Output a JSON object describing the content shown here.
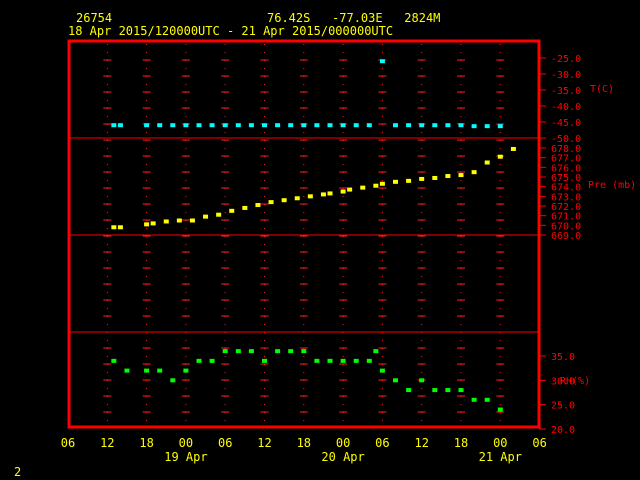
{
  "header": {
    "station_id": "26754",
    "location": "76.42S   -77.03E   2824M",
    "time_range": "18 Apr 2015/120000UTC - 21 Apr 2015/000000UTC"
  },
  "footer": {
    "page_number": "2"
  },
  "colors": {
    "background": "#000000",
    "frame": "#ff0000",
    "grid": "#ff2020",
    "text": "#ffff00",
    "temperature": "#00ffff",
    "pressure": "#ffff00",
    "humidity": "#00ff00"
  },
  "x_axis": {
    "tick_labels": [
      "06",
      "12",
      "18",
      "00",
      "06",
      "12",
      "18",
      "00",
      "06",
      "12",
      "18",
      "00",
      "06"
    ],
    "date_labels": [
      "19 Apr",
      "20 Apr",
      "21 Apr"
    ]
  },
  "chart_data": [
    {
      "type": "scatter",
      "ylabel": "T(C)",
      "ylim": [
        -50,
        -25
      ],
      "yticks": [
        "-25.0",
        "-30.0",
        "-35.0",
        "-40.0",
        "-45.0",
        "-50.0"
      ],
      "x_hours": [
        13,
        14,
        18,
        20,
        22,
        24,
        26,
        28,
        30,
        32,
        34,
        36,
        38,
        40,
        42,
        44,
        46,
        48,
        50,
        52,
        54,
        56,
        58,
        60,
        62,
        64,
        66,
        68,
        70,
        72
      ],
      "values": [
        -46,
        -46,
        -46,
        -46,
        -46,
        -46,
        -46,
        -46,
        -46,
        -46,
        -46,
        -46,
        -46,
        -46,
        -46,
        -46,
        -46,
        -46,
        -46,
        -46,
        -26,
        -46,
        -46,
        -46,
        -46,
        -46,
        -46,
        -46.3,
        -46.3,
        -46.3
      ]
    },
    {
      "type": "scatter",
      "ylabel": "Pre (mb)",
      "ylim": [
        669,
        678
      ],
      "yticks": [
        "678.0",
        "677.0",
        "676.0",
        "675.0",
        "674.0",
        "673.0",
        "672.0",
        "671.0",
        "670.0",
        "669.0"
      ],
      "x_hours": [
        13,
        14,
        18,
        19,
        21,
        23,
        25,
        27,
        29,
        31,
        33,
        35,
        37,
        39,
        41,
        43,
        45,
        46,
        48,
        49,
        51,
        53,
        54,
        56,
        58,
        60,
        62,
        64,
        66,
        68,
        70,
        72,
        74
      ],
      "values": [
        669.8,
        669.8,
        670.1,
        670.2,
        670.4,
        670.5,
        670.5,
        670.9,
        671.1,
        671.5,
        671.8,
        672.1,
        672.4,
        672.6,
        672.8,
        673.0,
        673.2,
        673.3,
        673.5,
        673.7,
        673.9,
        674.1,
        674.3,
        674.5,
        674.6,
        674.8,
        674.9,
        675.1,
        675.2,
        675.5,
        676.5,
        677.1,
        677.9
      ]
    },
    {
      "type": "scatter",
      "ylabel": "RH(%)",
      "ylim": [
        20,
        35
      ],
      "yticks": [
        "35.0",
        "30.0",
        "25.0",
        "20.0"
      ],
      "x_hours": [
        13,
        15,
        18,
        20,
        22,
        24,
        26,
        28,
        30,
        32,
        34,
        36,
        38,
        40,
        42,
        44,
        46,
        48,
        50,
        52,
        53,
        54,
        56,
        58,
        60,
        62,
        64,
        66,
        68,
        70,
        72
      ],
      "values": [
        34,
        32,
        32,
        32,
        30,
        32,
        34,
        34,
        36,
        36,
        36,
        34,
        36,
        36,
        36,
        34,
        34,
        34,
        34,
        34,
        36,
        32,
        30,
        28,
        30,
        28,
        28,
        28,
        26,
        26,
        24
      ]
    }
  ]
}
